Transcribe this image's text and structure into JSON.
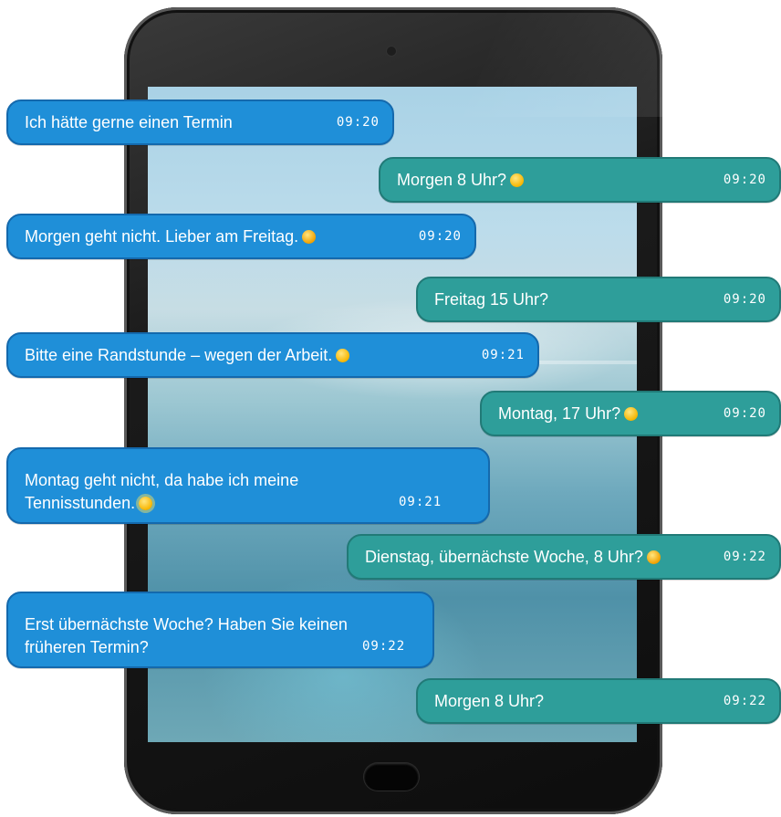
{
  "messages": [
    {
      "side": "incoming",
      "text": "Ich hätte gerne einen Termin",
      "time": "09:20",
      "emoji": ""
    },
    {
      "side": "outgoing",
      "text": "Morgen 8 Uhr?",
      "time": "09:20",
      "emoji": "grinning-face"
    },
    {
      "side": "incoming",
      "text": "Morgen geht nicht. Lieber am Freitag.",
      "time": "09:20",
      "emoji": "pouting-face"
    },
    {
      "side": "outgoing",
      "text": "Freitag 15 Uhr?",
      "time": "09:20",
      "emoji": ""
    },
    {
      "side": "incoming",
      "text": "Bitte eine Randstunde – wegen der Arbeit.",
      "time": "09:21",
      "emoji": "surprised-face"
    },
    {
      "side": "outgoing",
      "text": "Montag, 17 Uhr?",
      "time": "09:20",
      "emoji": "smiling-face"
    },
    {
      "side": "incoming",
      "text": "Montag geht nicht, da habe ich meine Tennisstunden.",
      "time": "09:21",
      "emoji": "sun-face"
    },
    {
      "side": "outgoing",
      "text": "Dienstag, übernächste Woche, 8 Uhr?",
      "time": "09:22",
      "emoji": "frowning-face"
    },
    {
      "side": "incoming",
      "text": "Erst übernächste Woche? Haben Sie keinen früheren Termin?",
      "time": "09:22",
      "emoji": ""
    },
    {
      "side": "outgoing",
      "text": "Morgen 8 Uhr?",
      "time": "09:22",
      "emoji": ""
    }
  ],
  "colors": {
    "incoming_bubble": "#1f8fd8",
    "outgoing_bubble": "#2e9e9a",
    "tablet_frame": "#1b1b1b"
  }
}
